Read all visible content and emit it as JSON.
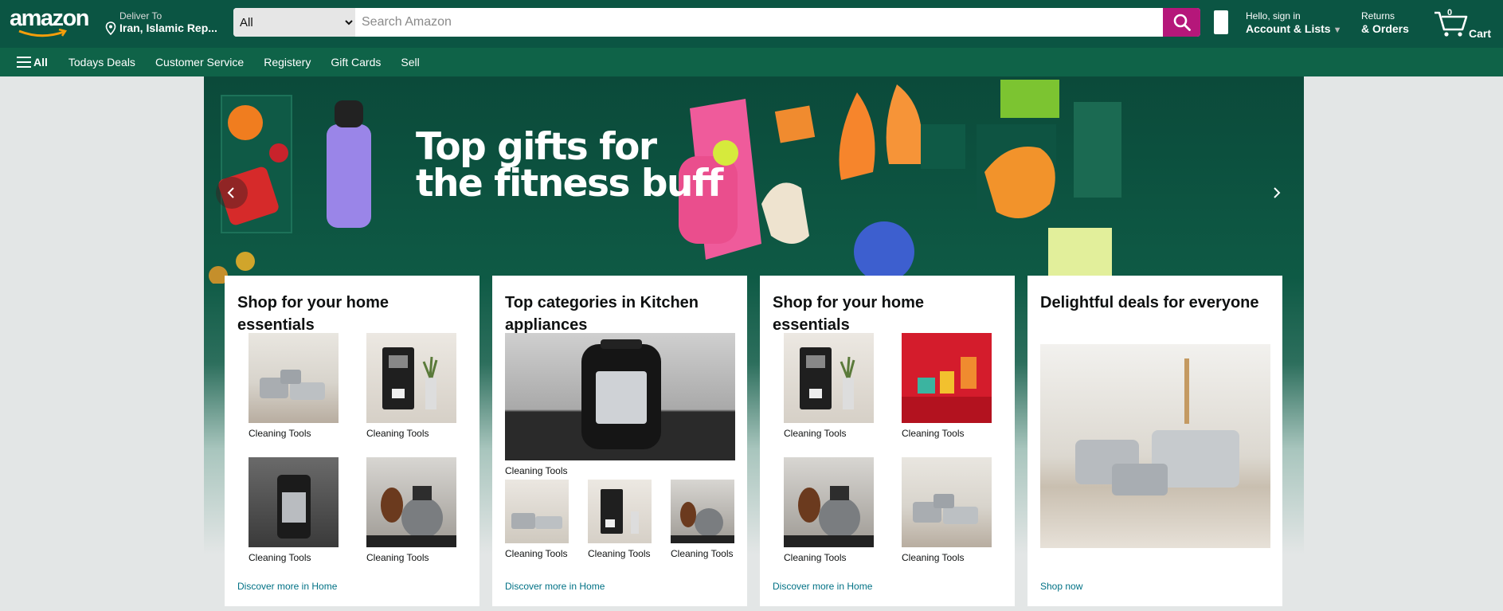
{
  "header": {
    "logo_text": "amazon",
    "deliver_label": "Deliver To",
    "deliver_location": "Iran, Islamic Rep...",
    "search": {
      "category": "All",
      "placeholder": "Search Amazon"
    },
    "account_line1": "Hello, sign in",
    "account_line2": "Account & Lists",
    "returns_line1": "Returns",
    "returns_line2": "& Orders",
    "cart_count": "0",
    "cart_label": "Cart"
  },
  "nav": {
    "all_label": "All",
    "items": [
      "Todays Deals",
      "Customer Service",
      "Registery",
      "Gift Cards",
      "Sell"
    ]
  },
  "hero": {
    "title_line1": "Top gifts for",
    "title_line2": "the fitness buff"
  },
  "cards": [
    {
      "title": "Shop for your home essentials",
      "items": [
        "Cleaning Tools",
        "Cleaning Tools",
        "Cleaning Tools",
        "Cleaning Tools"
      ],
      "link": "Discover more in Home"
    },
    {
      "title": "Top categories in Kitchen appliances",
      "main_caption": "Cleaning Tools",
      "items": [
        "Cleaning Tools",
        "Cleaning Tools",
        "Cleaning Tools"
      ],
      "link": "Discover more in Home"
    },
    {
      "title": "Shop for your home essentials",
      "items": [
        "Cleaning Tools",
        "Cleaning Tools",
        "Cleaning Tools",
        "Cleaning Tools"
      ],
      "link": "Discover more in Home"
    },
    {
      "title": "Delightful deals for everyone",
      "link": "Shop now"
    }
  ],
  "colors": {
    "header_bg": "#0b5543",
    "nav_bg": "#0f6348",
    "search_button": "#b5177a",
    "link": "#007185"
  }
}
